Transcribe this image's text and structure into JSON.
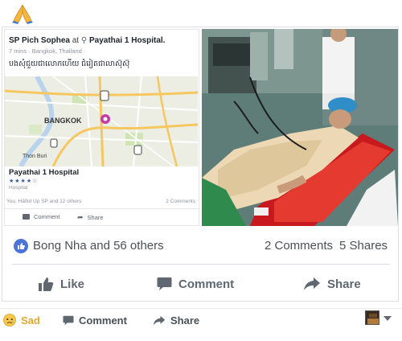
{
  "shared_post": {
    "author": "SP Pich Sophea",
    "at_word": "at",
    "place_link": "Payathai 1 Hospital.",
    "meta": "7 mins · Bangkok, Thailand · ",
    "khmer_text": "បងសុំជួយជាលោកហើយ ជំរៀតជាលាស៊ុស៊ុ",
    "map": {
      "city_label": "BANGKOK",
      "district_label": "Thon Buri",
      "colors": {
        "water": "#b9d3ec",
        "major_road": "#f6c760",
        "park": "#cfe5b5",
        "pin": "#c23ba6"
      }
    },
    "place_name": "Payathai 1 Hospital",
    "place_stars": "★★★★☆",
    "place_category": "Hospital",
    "reactions_text": "You, Häfiid Up SP and 12 others",
    "comments_text": "2 Comments",
    "comment_label": "Comment",
    "share_label": "Share"
  },
  "post": {
    "reactions_text": "Bong Nha and 56 others",
    "comments_count": "2 Comments",
    "shares_count": "5 Shares",
    "actions": {
      "like": "Like",
      "comment": "Comment",
      "share": "Share"
    }
  },
  "bottom_bar": {
    "sad_label": "Sad",
    "comment_label": "Comment",
    "share_label": "Share"
  },
  "colors": {
    "facebook_blue": "#4b74d6",
    "sad_yellow": "#e6a72d",
    "text_gray": "#606770",
    "border": "#dddfe2"
  },
  "icons": [
    "pray-emoji",
    "location-pin-icon",
    "like-icon",
    "comment-icon",
    "share-icon",
    "sad-emoji-icon",
    "caret-down-icon"
  ]
}
